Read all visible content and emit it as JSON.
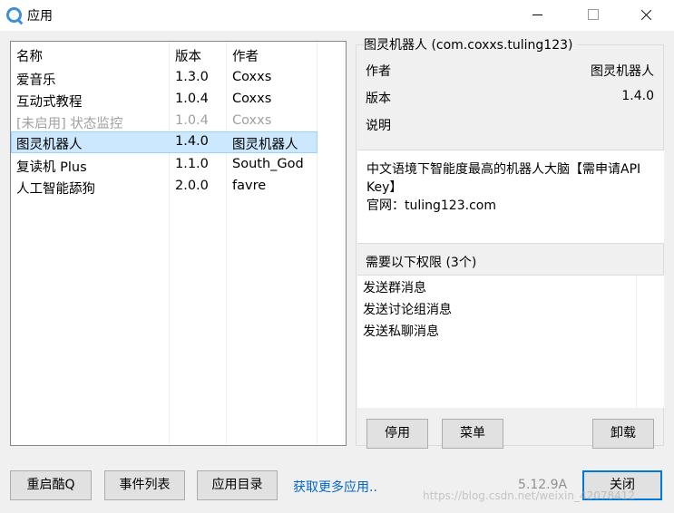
{
  "window": {
    "title": "应用"
  },
  "list": {
    "columns": [
      "名称",
      "版本",
      "作者"
    ],
    "rows": [
      {
        "name": "爱音乐",
        "version": "1.3.0",
        "author": "Coxxs"
      },
      {
        "name": "互动式教程",
        "version": "1.0.4",
        "author": "Coxxs"
      },
      {
        "name": "[未启用] 状态监控",
        "version": "1.0.4",
        "author": "Coxxs",
        "disabled": true
      },
      {
        "name": "图灵机器人",
        "version": "1.4.0",
        "author": "图灵机器人",
        "selected": true
      },
      {
        "name": "复读机 Plus",
        "version": "1.1.0",
        "author": "South_God"
      },
      {
        "name": "人工智能舔狗",
        "version": "2.0.0",
        "author": "favre"
      }
    ]
  },
  "detail": {
    "title": "图灵机器人 (com.coxxs.tuling123)",
    "author_label": "作者",
    "author_value": "图灵机器人",
    "version_label": "版本",
    "version_value": "1.4.0",
    "desc_label": "说明",
    "description_line1": "中文语境下智能度最高的机器人大脑【需申请API",
    "description_line2": "Key】",
    "description_line3": "官网：tuling123.com",
    "permissions_header": "需要以下权限 (3个)",
    "permissions": [
      "发送群消息",
      "发送讨论组消息",
      "发送私聊消息"
    ],
    "buttons": {
      "disable": "停用",
      "menu": "菜单",
      "uninstall": "卸载"
    }
  },
  "footer": {
    "restart": "重启酷Q",
    "events": "事件列表",
    "app_dir": "应用目录",
    "more_link": "获取更多应用..",
    "version": "5.12.9A",
    "close": "关闭",
    "watermark": "https://blog.csdn.net/weixin_42078412"
  },
  "colors": {
    "selection": "#cce8ff",
    "link": "#0066cc",
    "accent": "#0078d7"
  }
}
